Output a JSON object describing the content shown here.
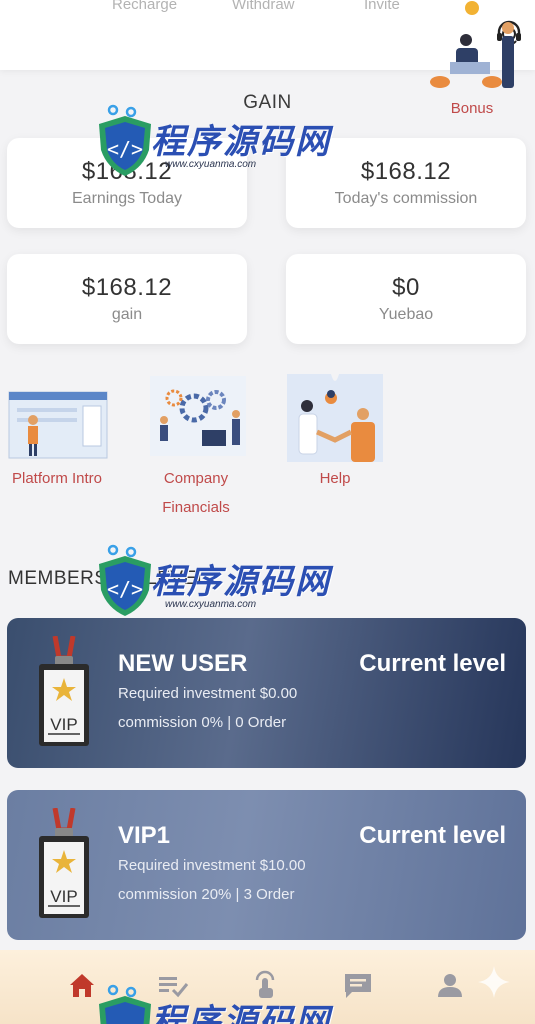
{
  "top_nav": {
    "tabs": [
      "Recharge",
      "Withdraw",
      "Invite"
    ],
    "support_icon": "headset-icon"
  },
  "gain": {
    "title": "GAIN",
    "cards": [
      {
        "value": "$168.12",
        "label": "Earnings Today"
      },
      {
        "value": "$168.12",
        "label": "Today's commission"
      },
      {
        "value": "$168.12",
        "label": "gain"
      },
      {
        "value": "$0",
        "label": "Yuebao"
      }
    ]
  },
  "features": [
    {
      "label_1": "Platform Intro",
      "label_2": ""
    },
    {
      "label_1": "Company",
      "label_2": "Financials"
    },
    {
      "label_1": "Help",
      "label_2": ""
    },
    {
      "label_1": "Bonus",
      "label_2": ""
    }
  ],
  "members": {
    "title": "MEMBERSHIP LEVEL",
    "levels": [
      {
        "name": "NEW USER",
        "status": "Current level",
        "requirement": "Required investment $0.00",
        "commission": "commission 0% | 0 Order",
        "badge_text": "VIP"
      },
      {
        "name": "VIP1",
        "status": "Current level",
        "requirement": "Required investment $10.00",
        "commission": "commission 20% | 3 Order",
        "badge_text": "VIP"
      }
    ]
  },
  "bottom_nav": {
    "items": [
      "home-icon",
      "tasks-icon",
      "touch-icon",
      "message-icon",
      "user-icon"
    ],
    "active_color": "#c0392b"
  },
  "watermark": {
    "text": "程序源码网",
    "url": "www.cxyuanma.com"
  }
}
